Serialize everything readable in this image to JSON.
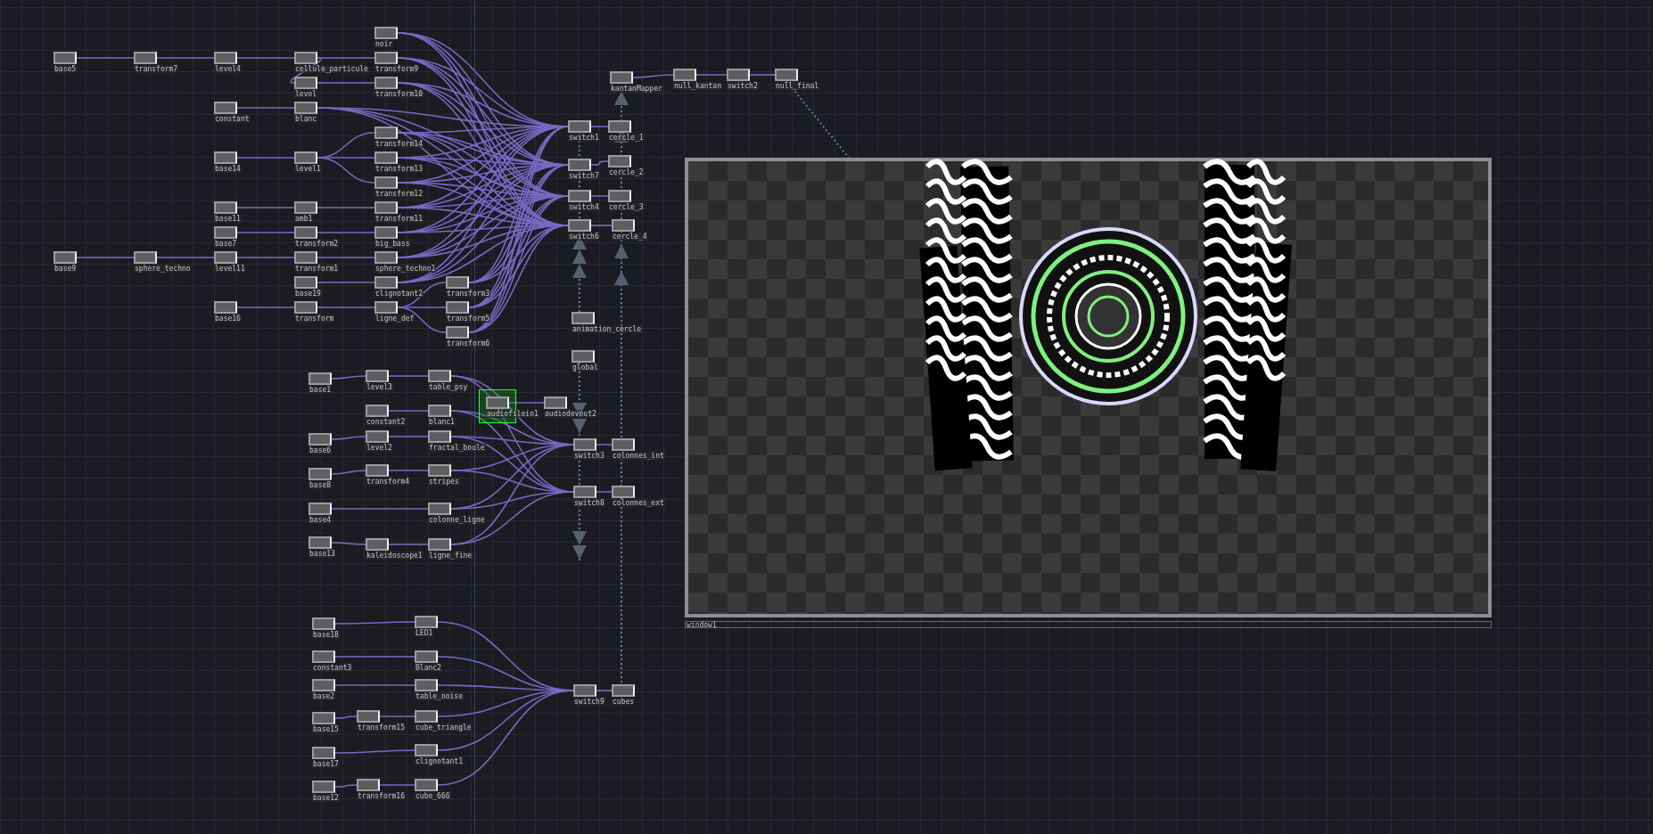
{
  "nodes": [
    {
      "name": "base5",
      "selected": false
    },
    {
      "name": "transform7",
      "selected": false
    },
    {
      "name": "level4",
      "selected": false
    },
    {
      "name": "cellule_particule",
      "selected": false
    },
    {
      "name": "noir",
      "selected": false
    },
    {
      "name": "transform9",
      "selected": false
    },
    {
      "name": "level",
      "selected": false
    },
    {
      "name": "transform10",
      "selected": false
    },
    {
      "name": "constant",
      "selected": false
    },
    {
      "name": "blanc",
      "selected": false
    },
    {
      "name": "base14",
      "selected": false
    },
    {
      "name": "level1",
      "selected": false
    },
    {
      "name": "transform14",
      "selected": false
    },
    {
      "name": "transform13",
      "selected": false
    },
    {
      "name": "transform12",
      "selected": false
    },
    {
      "name": "base11",
      "selected": false
    },
    {
      "name": "amb1",
      "selected": false
    },
    {
      "name": "transform11",
      "selected": false
    },
    {
      "name": "base7",
      "selected": false
    },
    {
      "name": "transform2",
      "selected": false
    },
    {
      "name": "big_bass",
      "selected": false
    },
    {
      "name": "base9",
      "selected": false
    },
    {
      "name": "sphere_techno",
      "selected": false
    },
    {
      "name": "level11",
      "selected": false
    },
    {
      "name": "transform1",
      "selected": false
    },
    {
      "name": "sphere_techno1",
      "selected": false
    },
    {
      "name": "base19",
      "selected": false
    },
    {
      "name": "clignotant2",
      "selected": false
    },
    {
      "name": "transform3",
      "selected": false
    },
    {
      "name": "base16",
      "selected": false
    },
    {
      "name": "transform",
      "selected": false
    },
    {
      "name": "ligne_def",
      "selected": false
    },
    {
      "name": "transform5",
      "selected": false
    },
    {
      "name": "transform6",
      "selected": false
    },
    {
      "name": "kantanMapper",
      "selected": false
    },
    {
      "name": "null_kantan",
      "selected": false
    },
    {
      "name": "switch2",
      "selected": false
    },
    {
      "name": "null_final",
      "selected": false
    },
    {
      "name": "switch1",
      "selected": false
    },
    {
      "name": "cercle_1",
      "selected": false
    },
    {
      "name": "switch7",
      "selected": false
    },
    {
      "name": "cercle_2",
      "selected": false
    },
    {
      "name": "switch4",
      "selected": false
    },
    {
      "name": "cercle_3",
      "selected": false
    },
    {
      "name": "switch6",
      "selected": false
    },
    {
      "name": "cercle_4",
      "selected": false
    },
    {
      "name": "audiofilein1",
      "selected": true
    },
    {
      "name": "audiodevout2",
      "selected": false
    },
    {
      "name": "animation_cercle",
      "selected": false
    },
    {
      "name": "global",
      "selected": false
    },
    {
      "name": "base1",
      "selected": false
    },
    {
      "name": "level3",
      "selected": false
    },
    {
      "name": "table_psy",
      "selected": false
    },
    {
      "name": "constant2",
      "selected": false
    },
    {
      "name": "blanc1",
      "selected": false
    },
    {
      "name": "base6",
      "selected": false
    },
    {
      "name": "level2",
      "selected": false
    },
    {
      "name": "fractal_boule",
      "selected": false
    },
    {
      "name": "base8",
      "selected": false
    },
    {
      "name": "transform4",
      "selected": false
    },
    {
      "name": "stripes",
      "selected": false
    },
    {
      "name": "base4",
      "selected": false
    },
    {
      "name": "colonne_ligne",
      "selected": false
    },
    {
      "name": "base13",
      "selected": false
    },
    {
      "name": "kaleidoscope1",
      "selected": false
    },
    {
      "name": "ligne_fine",
      "selected": false
    },
    {
      "name": "switch3",
      "selected": false
    },
    {
      "name": "colonnes_int",
      "selected": false
    },
    {
      "name": "switch8",
      "selected": false
    },
    {
      "name": "colonnes_ext",
      "selected": false
    },
    {
      "name": "base18",
      "selected": false
    },
    {
      "name": "LED1",
      "selected": false
    },
    {
      "name": "constant3",
      "selected": false
    },
    {
      "name": "Blanc2",
      "selected": false
    },
    {
      "name": "base2",
      "selected": false
    },
    {
      "name": "table_noise",
      "selected": false
    },
    {
      "name": "base15",
      "selected": false
    },
    {
      "name": "transform15",
      "selected": false
    },
    {
      "name": "cube_triangle",
      "selected": false
    },
    {
      "name": "base17",
      "selected": false
    },
    {
      "name": "clignotant1",
      "selected": false
    },
    {
      "name": "base12",
      "selected": false
    },
    {
      "name": "transform16",
      "selected": false
    },
    {
      "name": "cube_666",
      "selected": false
    },
    {
      "name": "switch9",
      "selected": false
    },
    {
      "name": "cubes",
      "selected": false
    }
  ],
  "viewer": {
    "label": "window1"
  }
}
